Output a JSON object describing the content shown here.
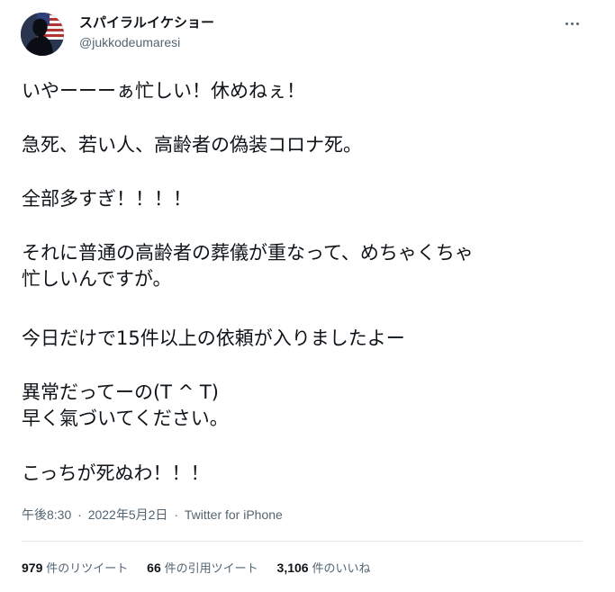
{
  "author": {
    "display_name": "スパイラルイケショー",
    "handle": "@jukkodeumaresi"
  },
  "tweet": {
    "lines": [
      "いやーーーぁ忙しい！休めねぇ！",
      "急死、若い人、高齢者の偽装コロナ死。",
      "全部多すぎ！！！！",
      "それに普通の高齢者の葬儀が重なって、めちゃくちゃ",
      "忙しいんですが。",
      "今日だけで15件以上の依頼が入りましたよー",
      "異常だってーの(T ^ T)",
      "早く氣づいてください。",
      "こっちが死ぬわ！！！"
    ]
  },
  "meta": {
    "time": "午後8:30",
    "separator": "·",
    "date": "2022年5月2日",
    "source": "Twitter for iPhone"
  },
  "stats": [
    {
      "count": "979",
      "label": "件のリツイート"
    },
    {
      "count": "66",
      "label": "件の引用ツイート"
    },
    {
      "count": "3,106",
      "label": "件のいいね"
    }
  ],
  "icons": {
    "more": "more-horizontal-icon",
    "avatar_flag": "us-flag"
  },
  "colors": {
    "text_primary": "#0f1419",
    "text_secondary": "#536471",
    "divider": "#e1e7eb"
  }
}
